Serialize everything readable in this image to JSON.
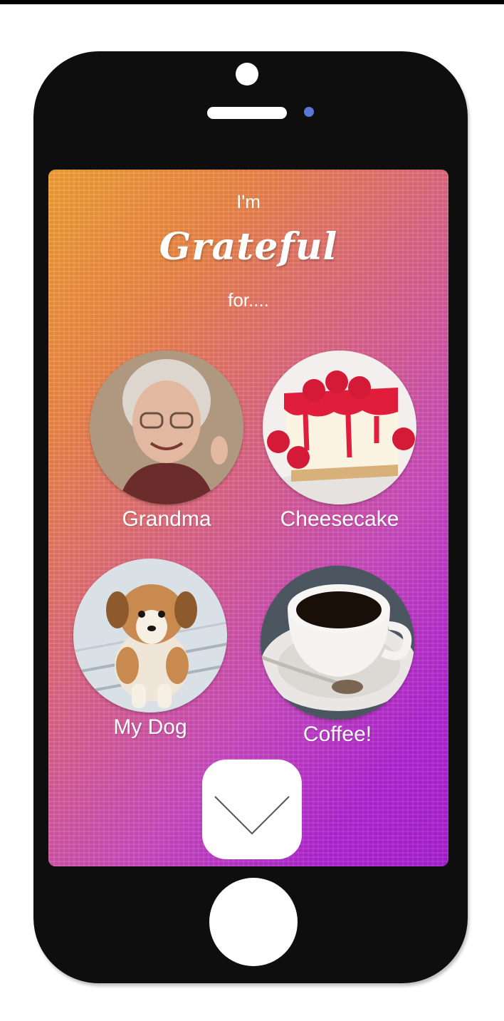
{
  "header": {
    "line1": "I'm",
    "main": "Grateful",
    "line3": "for...."
  },
  "items": [
    {
      "label": "Grandma",
      "icon": "grandma-photo"
    },
    {
      "label": "Cheesecake",
      "icon": "cheesecake-photo"
    },
    {
      "label": "My Dog",
      "icon": "dog-photo"
    },
    {
      "label": "Coffee!",
      "icon": "coffee-photo"
    }
  ],
  "confirm_icon": "chevron-down-icon",
  "colors": {
    "gradient_start": "#f4a236",
    "gradient_end": "#a820d4",
    "phone_body": "#0e0e0e",
    "sensor": "#5878d8"
  }
}
